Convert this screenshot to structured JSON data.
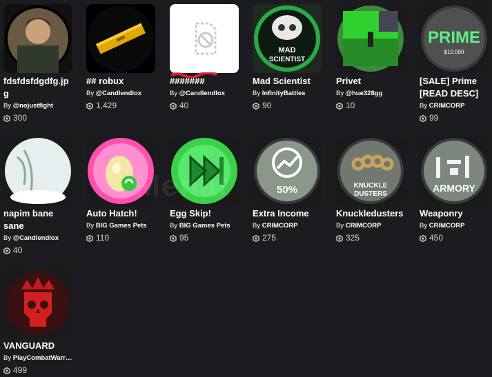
{
  "by_prefix": "By ",
  "watermark": "Menat",
  "items": [
    {
      "name": "fdsfdsfdgdfg.jpg",
      "creator": "@nojustfight",
      "price": "300",
      "icon": "portrait-icon"
    },
    {
      "name": "## robux",
      "creator": "@Candlendlox",
      "price": "1,429",
      "icon": "gold-bar-icon"
    },
    {
      "name": "#######",
      "creator": "@Candlendlox",
      "price": "40",
      "icon": "broken-image-icon"
    },
    {
      "name": "Mad Scientist",
      "creator": "InfinityBattles",
      "price": "90",
      "icon": "mad-scientist-icon",
      "label": "MAD\nSCIENTIST"
    },
    {
      "name": "Privet",
      "creator": "@hue328gg",
      "price": "10",
      "icon": "green-room-icon"
    },
    {
      "name": "[SALE] Prime [READ DESC]",
      "creator": "CRIMCORP",
      "price": "99",
      "icon": "prime-badge-icon",
      "label": "PRIME",
      "sublabel": "$10,000"
    },
    {
      "name": "napim bane sane",
      "creator": "@Candlendlox",
      "price": "40",
      "icon": "snow-tree-icon"
    },
    {
      "name": "Auto Hatch!",
      "creator": "BIG Games Pets",
      "price": "110",
      "icon": "egg-icon"
    },
    {
      "name": "Egg Skip!",
      "creator": "BIG Games Pets",
      "price": "95",
      "icon": "fast-forward-icon"
    },
    {
      "name": "Extra Income",
      "creator": "CRIMCORP",
      "price": "275",
      "icon": "income-chart-icon",
      "label": "50%"
    },
    {
      "name": "Knuckledusters",
      "creator": "CRIMCORP",
      "price": "325",
      "icon": "knuckleduster-icon",
      "label": "KNUCKLE\nDUSTERS"
    },
    {
      "name": "Weaponry",
      "creator": "CRIMCORP",
      "price": "450",
      "icon": "armory-icon",
      "label": "ARMORY"
    },
    {
      "name": "VANGUARD",
      "creator": "PlayCombatWarri...",
      "price": "499",
      "icon": "skull-crown-icon"
    }
  ],
  "colors": {
    "background": "#1c1c20",
    "thumb_bg": "#393b3d",
    "price_text": "#d4d4d4"
  }
}
